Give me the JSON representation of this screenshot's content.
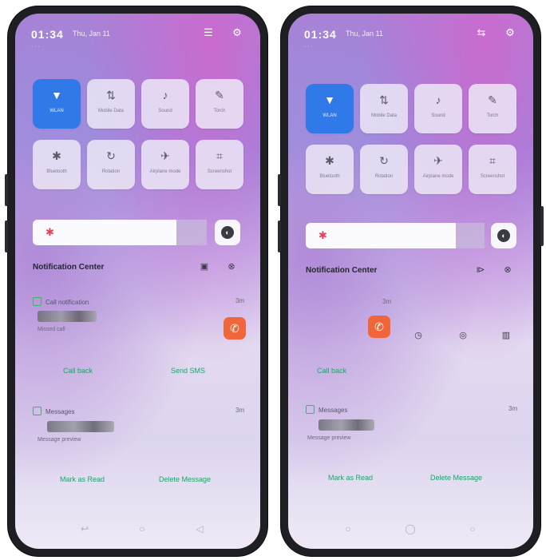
{
  "left": {
    "time": "01:34",
    "date": "Thu, Jan 11",
    "subline": "· · ·",
    "tiles": [
      {
        "label": "WLAN",
        "icon": "▼",
        "active": true
      },
      {
        "label": "Mobile Data",
        "icon": "⇅",
        "active": false
      },
      {
        "label": "Sound",
        "icon": "♪",
        "active": false
      },
      {
        "label": "Torch",
        "icon": "✎",
        "active": false
      },
      {
        "label": "Bluetooth",
        "icon": "✱",
        "active": false
      },
      {
        "label": "Rotation",
        "icon": "↻",
        "active": false
      },
      {
        "label": "Airplane mode",
        "icon": "✈",
        "active": false
      },
      {
        "label": "Screenshot",
        "icon": "⌗",
        "active": false
      }
    ],
    "nc_title": "Notification Center",
    "notif1": {
      "app": "Call notification",
      "time": "3m",
      "sub": "Missed call",
      "act1": "Call back",
      "act2": "Send SMS"
    },
    "notif2": {
      "app": "Messages",
      "time": "3m",
      "sub": "Message preview",
      "act1": "Mark as Read",
      "act2": "Delete Message"
    }
  },
  "right": {
    "time": "01:34",
    "date": "Thu, Jan 11",
    "subline": "· · ·",
    "tiles": [
      {
        "label": "WLAN",
        "icon": "▼",
        "active": true
      },
      {
        "label": "Mobile Data",
        "icon": "⇅",
        "active": false
      },
      {
        "label": "Sound",
        "icon": "♪",
        "active": false
      },
      {
        "label": "Torch",
        "icon": "✎",
        "active": false
      },
      {
        "label": "Bluetooth",
        "icon": "✱",
        "active": false
      },
      {
        "label": "Rotation",
        "icon": "↻",
        "active": false
      },
      {
        "label": "Airplane mode",
        "icon": "✈",
        "active": false
      },
      {
        "label": "Screenshot",
        "icon": "⌗",
        "active": false
      }
    ],
    "nc_title": "Notification Center",
    "notif1": {
      "time": "3m",
      "act1": "Call back"
    },
    "notif2": {
      "app": "Messages",
      "time": "3m",
      "sub": "Message preview",
      "act1": "Mark as Read",
      "act2": "Delete Message"
    }
  }
}
